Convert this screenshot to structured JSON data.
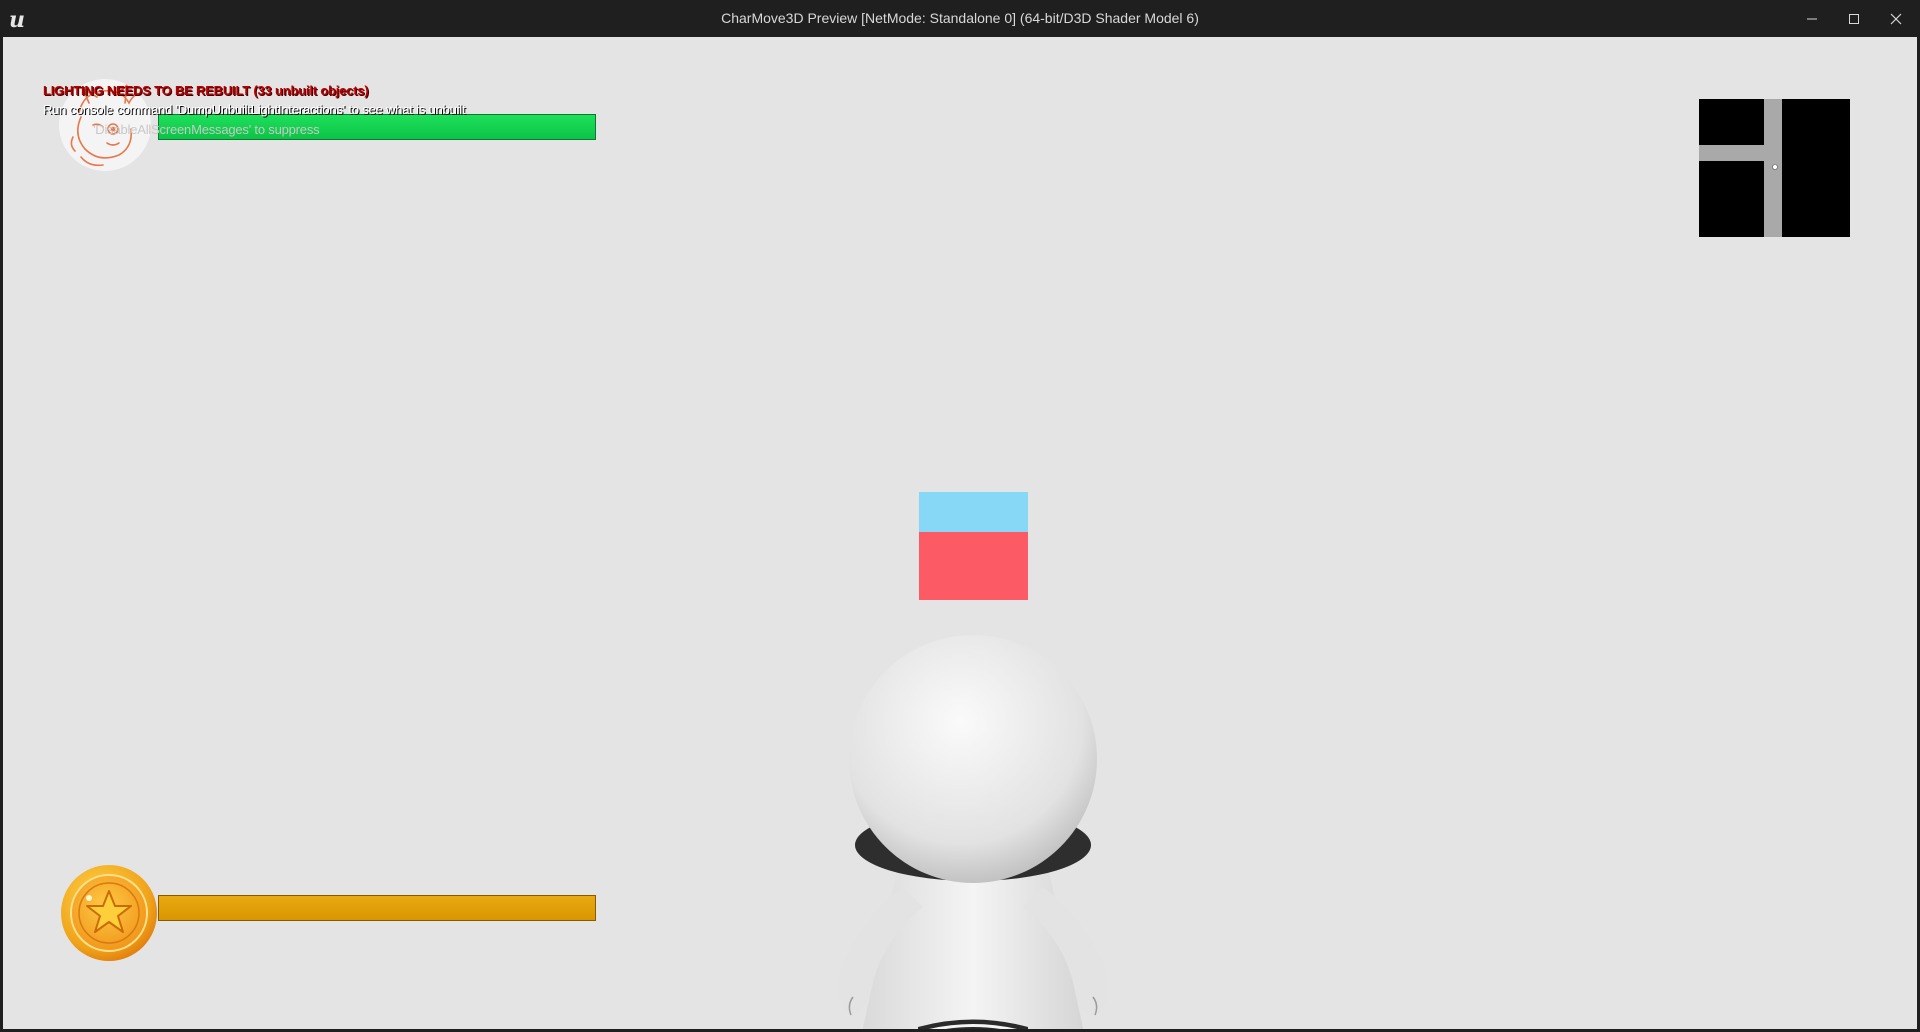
{
  "window": {
    "title": "CharMove3D Preview [NetMode: Standalone 0]  (64-bit/D3D Shader Model 6)",
    "app_icon": "unreal-engine-logo-icon",
    "controls": {
      "minimize_icon": "minimize-icon",
      "maximize_icon": "maximize-icon",
      "close_icon": "close-icon"
    }
  },
  "viewport": {
    "background_color": "#e4e4e4"
  },
  "screen_messages": {
    "warning": "LIGHTING NEEDS TO BE REBUILT (33 unbuilt objects)",
    "console_hint": "Run console command 'DumpUnbuiltLightInteractions' to see what is unbuilt",
    "suppress_hint": "'DisableAllScreenMessages' to suppress",
    "warning_color": "#b80000"
  },
  "hud": {
    "health": {
      "icon": "character-portrait-icon",
      "fill_fraction": 1.0,
      "fill_color": "#12d34f"
    },
    "coins": {
      "icon": "star-coin-icon",
      "fill_fraction": 1.0,
      "fill_color": "#e09f05"
    },
    "minimap": {
      "background": "#000000",
      "path_color": "#a9a9a9",
      "player_marker": "player-dot-icon"
    }
  },
  "scene": {
    "head_marker_top_color": "#87d8f7",
    "head_marker_bottom_color": "#fc5b65",
    "character": "white-character-model"
  }
}
